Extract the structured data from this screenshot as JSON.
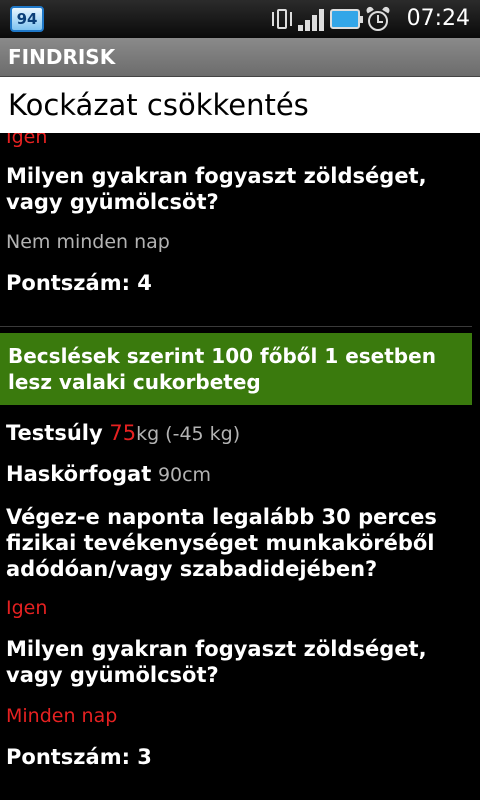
{
  "status_bar": {
    "notification_count": "94",
    "time": "07:24",
    "icons": [
      "vibrate-icon",
      "signal-icon",
      "battery-icon",
      "alarm-icon"
    ]
  },
  "app": {
    "title": "FINDRISK"
  },
  "header": {
    "title": "Kockázat csökkentés"
  },
  "top_section": {
    "partial_answer": "Igen",
    "question": "Milyen gyakran fogyaszt zöldséget, vagy gyümölcsöt?",
    "answer": "Nem minden nap",
    "score_label": "Pontszám: 4"
  },
  "banner": {
    "text": "Becslések szerint 100 főből 1 esetben lesz valaki cukorbeteg",
    "color": "#3a7a0d"
  },
  "bottom_section": {
    "weight_label": "Testsúly",
    "weight_value": "75",
    "weight_unit": "kg (-45 kg)",
    "waist_label": "Haskörfogat",
    "waist_value": "90cm",
    "activity_question": "Végez-e naponta legalább 30 perces fizikai tevékenységet munkaköréből adódóan/vagy szabadidejében?",
    "activity_answer": "Igen",
    "veg_question": "Milyen gyakran fogyaszt zöldséget, vagy gyümölcsöt?",
    "veg_answer": "Minden nap",
    "score_label": "Pontszám: 3"
  },
  "colors": {
    "highlight": "#e62121",
    "muted": "#b3b3b3"
  }
}
